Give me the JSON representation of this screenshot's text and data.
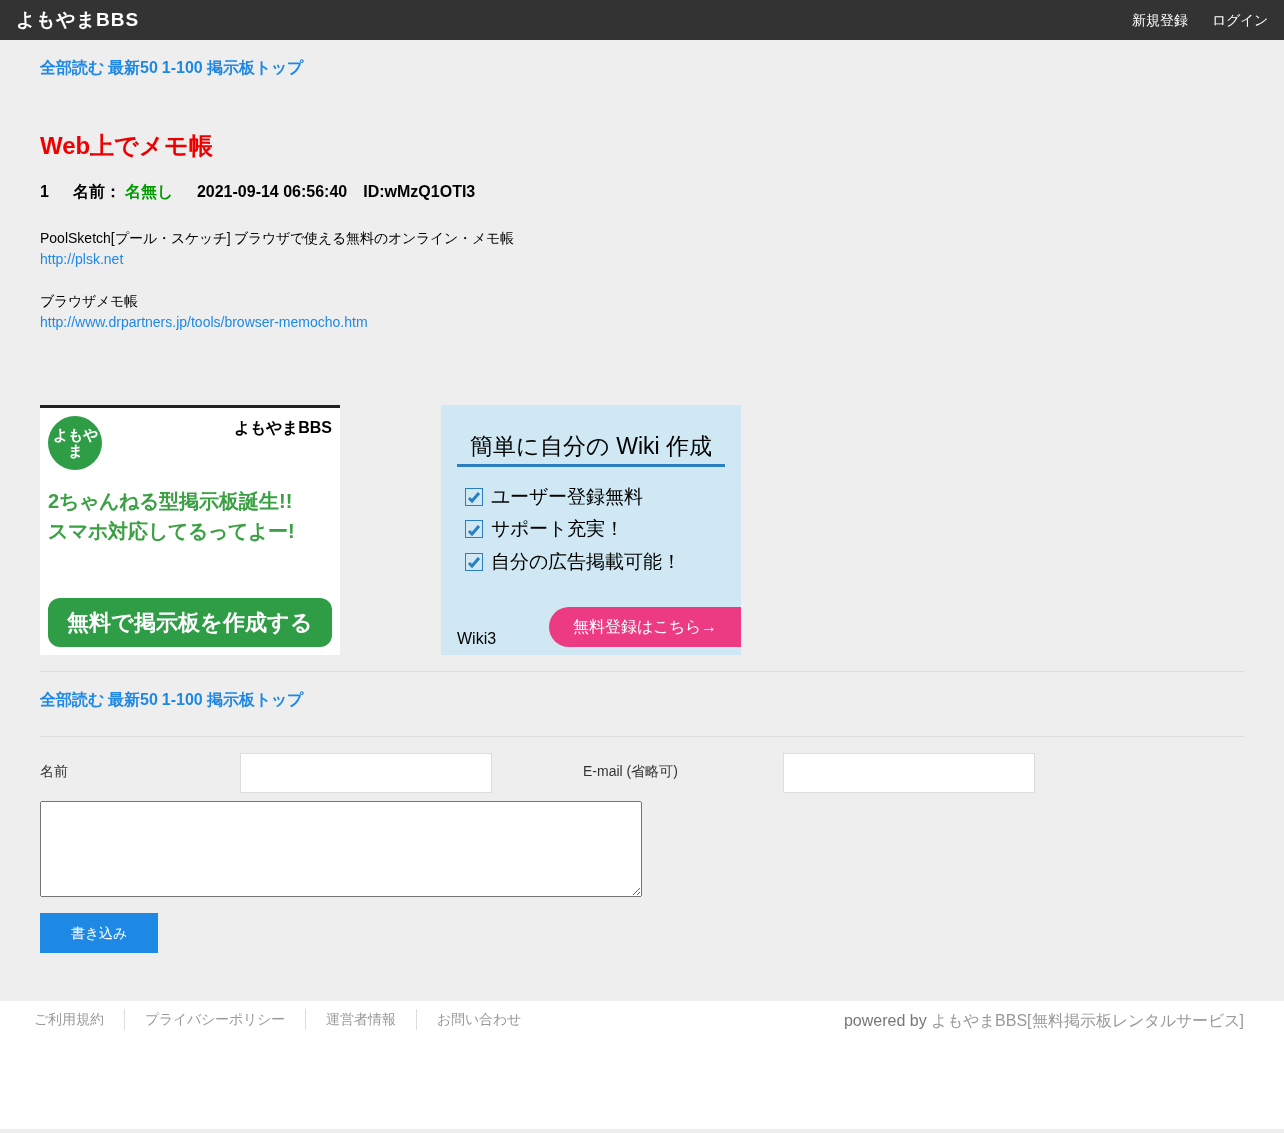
{
  "header": {
    "logo": "よもやまBBS",
    "links": [
      "新規登録",
      "ログイン"
    ]
  },
  "thread_nav_top": [
    "全部読む",
    "最新50",
    "1-100",
    "掲示板トップ"
  ],
  "thread_title": "Web上でメモ帳",
  "posts": [
    {
      "number": "1",
      "name_label": "名前：",
      "name": "名無し",
      "date": "2021-09-14 06:56:40",
      "id": "ID:wMzQ1OTI3",
      "body": [
        {
          "kind": "text",
          "text": "PoolSketch[プール・スケッチ] ブラウザで使える無料のオンライン・メモ帳"
        },
        {
          "kind": "link",
          "text": "http://plsk.net"
        },
        {
          "kind": "blank"
        },
        {
          "kind": "text",
          "text": "ブラウザメモ帳"
        },
        {
          "kind": "link",
          "text": "http://www.drpartners.jp/tools/browser-memocho.htm"
        }
      ]
    }
  ],
  "banners": [
    {
      "kind": "bbs",
      "badge": "よもやま",
      "brand": "よもやまBBS",
      "lines": [
        "2ちゃんねる型掲示板誕生!!",
        "スマホ対応してるってよー!"
      ],
      "cta": "無料で掲示板を作成する"
    },
    {
      "kind": "wiki",
      "heading": "簡単に自分の Wiki 作成",
      "lines": [
        "ユーザー登録無料",
        "サポート充実！",
        "自分の広告掲載可能！"
      ],
      "brand": "Wiki3",
      "cta": "無料登録はこちら→"
    }
  ],
  "thread_nav_bottom": [
    "全部読む",
    "最新50",
    "1-100",
    "掲示板トップ"
  ],
  "form": {
    "name_label": "名前",
    "email_label": "E-mail (省略可)",
    "submit": "書き込み"
  },
  "footer": {
    "links": [
      "ご利用規約",
      "プライバシーポリシー",
      "運営者情報",
      "お問い合わせ"
    ],
    "powered_prefix": "powered by",
    "powered_link": "よもやまBBS[無料掲示板レンタルサービス]"
  }
}
